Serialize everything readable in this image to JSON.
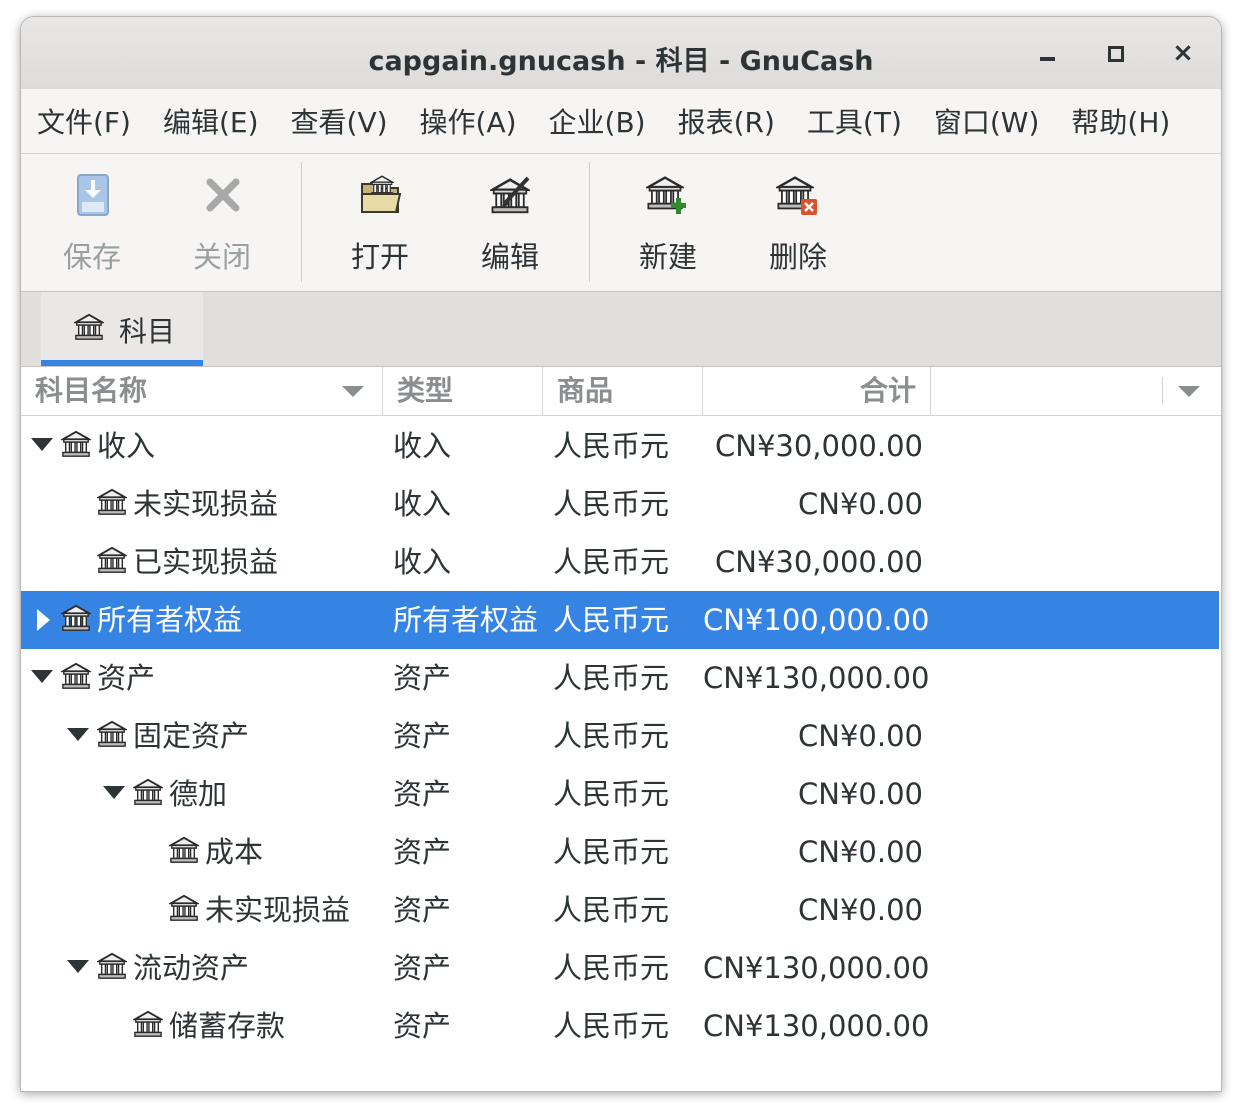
{
  "window": {
    "title": "capgain.gnucash - 科目 - GnuCash",
    "close_glyph": "×"
  },
  "menu": [
    "文件(F)",
    "编辑(E)",
    "查看(V)",
    "操作(A)",
    "企业(B)",
    "报表(R)",
    "工具(T)",
    "窗口(W)",
    "帮助(H)"
  ],
  "toolbar": {
    "save": "保存",
    "close": "关闭",
    "open": "打开",
    "edit": "编辑",
    "new": "新建",
    "delete": "删除"
  },
  "tab": {
    "label": "科目",
    "icon": "account-icon"
  },
  "columns": {
    "name": "科目名称",
    "type": "类型",
    "commodity": "商品",
    "total": "合计"
  },
  "accounts": [
    {
      "name": "收入",
      "type": "收入",
      "commodity": "人民币元",
      "total": "CN¥30,000.00",
      "depth": 0,
      "expander": "expanded"
    },
    {
      "name": "未实现损益",
      "type": "收入",
      "commodity": "人民币元",
      "total": "CN¥0.00",
      "depth": 1,
      "expander": "none"
    },
    {
      "name": "已实现损益",
      "type": "收入",
      "commodity": "人民币元",
      "total": "CN¥30,000.00",
      "depth": 1,
      "expander": "none"
    },
    {
      "name": "所有者权益",
      "type": "所有者权益",
      "commodity": "人民币元",
      "total": "CN¥100,000.00",
      "depth": 0,
      "expander": "collapsed",
      "selected": true
    },
    {
      "name": "资产",
      "type": "资产",
      "commodity": "人民币元",
      "total": "CN¥130,000.00",
      "depth": 0,
      "expander": "expanded"
    },
    {
      "name": "固定资产",
      "type": "资产",
      "commodity": "人民币元",
      "total": "CN¥0.00",
      "depth": 1,
      "expander": "expanded"
    },
    {
      "name": "德加",
      "type": "资产",
      "commodity": "人民币元",
      "total": "CN¥0.00",
      "depth": 2,
      "expander": "expanded"
    },
    {
      "name": "成本",
      "type": "资产",
      "commodity": "人民币元",
      "total": "CN¥0.00",
      "depth": 3,
      "expander": "none"
    },
    {
      "name": "未实现损益",
      "type": "资产",
      "commodity": "人民币元",
      "total": "CN¥0.00",
      "depth": 3,
      "expander": "none"
    },
    {
      "name": "流动资产",
      "type": "资产",
      "commodity": "人民币元",
      "total": "CN¥130,000.00",
      "depth": 1,
      "expander": "expanded"
    },
    {
      "name": "储蓄存款",
      "type": "资产",
      "commodity": "人民币元",
      "total": "CN¥130,000.00",
      "depth": 2,
      "expander": "none"
    }
  ],
  "colors": {
    "selection": "#3584e4",
    "header_text": "#8b8e8f",
    "text": "#2e3436"
  }
}
